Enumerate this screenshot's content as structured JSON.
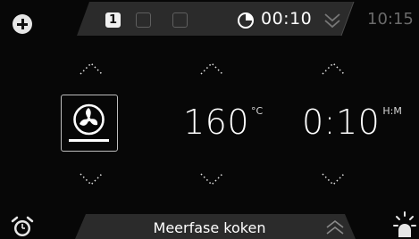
{
  "phases": {
    "active_label": "1"
  },
  "timer": {
    "value": "00:10"
  },
  "clock": {
    "time": "10:15"
  },
  "temperature": {
    "value": "160",
    "unit": "°C"
  },
  "duration": {
    "value": "0:10",
    "unit": "H:M"
  },
  "bottom": {
    "label": "Meerfase koken"
  },
  "icons": {
    "add": "plus-circle-icon",
    "timer": "timer-icon",
    "collapse": "chevron-double-down-icon",
    "mode": "fan-icon",
    "alarm": "alarm-clock-icon",
    "light": "light-icon"
  },
  "colors": {
    "background": "#070707",
    "bar": "#2b2b2b",
    "text": "#ffffff",
    "muted": "#6a6a6a"
  }
}
